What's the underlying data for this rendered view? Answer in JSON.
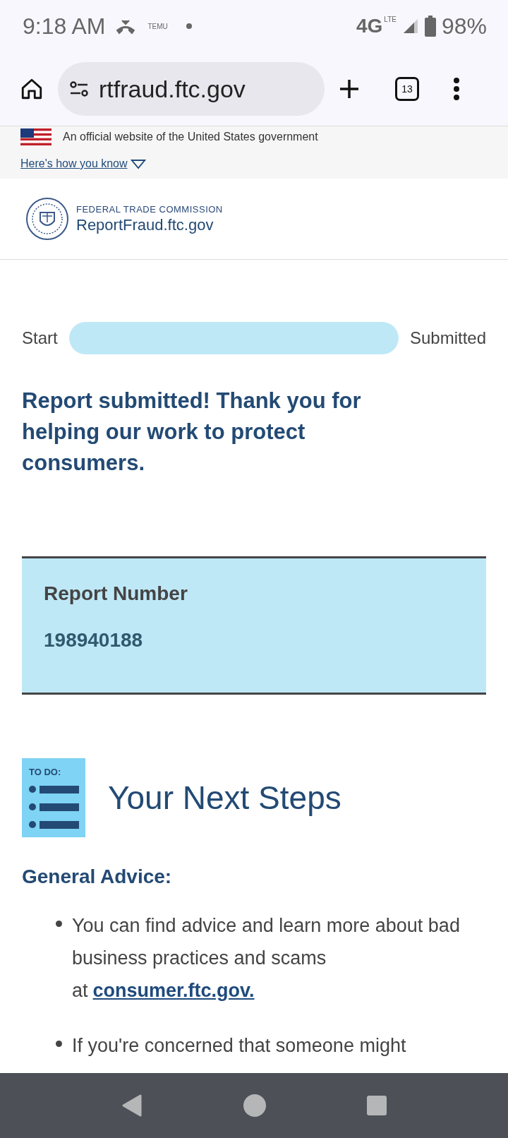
{
  "status_bar": {
    "time": "9:18 AM",
    "temu": "TEMU",
    "network": "4G",
    "network_sub": "LTE",
    "battery": "98%"
  },
  "browser": {
    "url": "rtfraud.ftc.gov",
    "tab_count": "13"
  },
  "gov_banner": {
    "text": "An official website of the United States government",
    "link": "Here's how you know"
  },
  "header": {
    "agency": "FEDERAL TRADE COMMISSION",
    "site": "ReportFraud.ftc.gov"
  },
  "progress": {
    "start": "Start",
    "end": "Submitted",
    "level": 1
  },
  "confirmation": "Report submitted! Thank you for helping our work to protect consumers.",
  "report": {
    "label": "Report Number",
    "number": "198940188"
  },
  "next_steps": {
    "icon_label": "TO DO:",
    "title": "Your Next Steps",
    "subtitle": "General Advice:",
    "items": [
      {
        "text": "You can find advice and learn more about bad business practices and scams at",
        "link": "consumer.ftc.gov."
      },
      {
        "text": "If you're concerned that someone might"
      }
    ]
  }
}
